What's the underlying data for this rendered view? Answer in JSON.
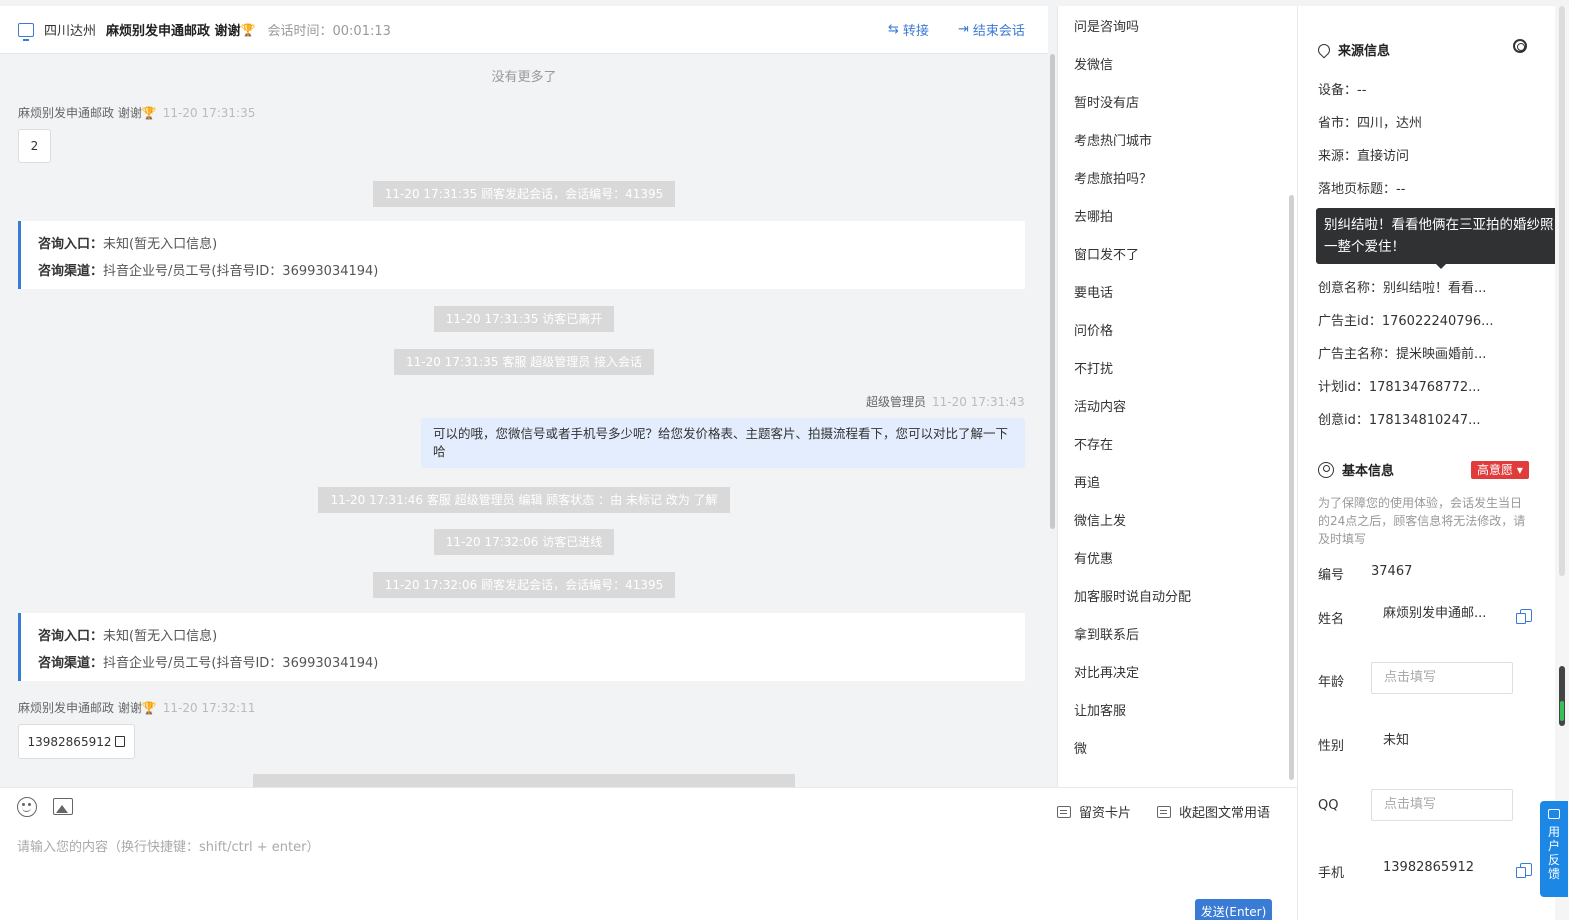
{
  "header": {
    "location": "四川达州",
    "visitor_name": "麻烦别发申通邮政 谢谢",
    "session_time": "会话时间：00:01:13",
    "transfer": "转接",
    "end_session": "结束会话"
  },
  "chat": {
    "no_more": "没有更多了",
    "visitor_label": "麻烦别发申通邮政 谢谢",
    "msg1_time": "11-20 17:31:35",
    "msg1_text": "2",
    "sys1": "11-20 17:31:35 顾客发起会话，会话编号：41395",
    "card1_entry_label": "咨询入口：",
    "card1_entry_val": "未知(暂无入口信息)",
    "card1_channel_label": "咨询渠道：",
    "card1_channel_val": "抖音企业号/员工号(抖音号ID：36993034194)",
    "sys2": "11-20 17:31:35 访客已离开",
    "sys3": "11-20 17:31:35 客服 超级管理员 接入会话",
    "agent_name": "超级管理员",
    "agent_time": "11-20 17:31:43",
    "agent_msg": "可以的哦，您微信号或者手机号多少呢？给您发价格表、主题客片、拍摄流程看下，您可以对比了解一下哈",
    "sys4": "11-20 17:31:46 客服 超级管理员 编辑 顾客状态 ：由 未标记 改为 了解",
    "sys5": "11-20 17:32:06 访客已进线",
    "sys6": "11-20 17:32:06 顾客发起会话，会话编号：41395",
    "card2_entry_label": "咨询入口：",
    "card2_entry_val": "未知(暂无入口信息)",
    "card2_channel_label": "咨询渠道：",
    "card2_channel_val": "抖音企业号/员工号(抖音号ID：36993034194)",
    "msg2_time": "11-20 17:32:11",
    "msg2_text": "13982865912"
  },
  "quick_replies": [
    "问是咨询吗",
    "发微信",
    "暂时没有店",
    "考虑热门城市",
    "考虑旅拍吗？",
    "去哪拍",
    "窗口发不了",
    "要电话",
    "问价格",
    "不打扰",
    "活动内容",
    "不存在",
    "再追",
    "微信上发",
    "有优惠",
    "加客服时说自动分配",
    "拿到联系后",
    "对比再决定",
    "让加客服",
    "微"
  ],
  "input": {
    "business_card": "留资卡片",
    "collapse_phrases": "收起图文常用语",
    "placeholder": "请输入您的内容（换行快捷键：shift/ctrl + enter）",
    "send": "发送(Enter)"
  },
  "source_info": {
    "title": "来源信息",
    "device": "设备：--",
    "province": "省市：四川，达州",
    "source": "来源：直接访问",
    "landing_title": "落地页标题：--",
    "tooltip": "别纠结啦！看看他俩在三亚拍的婚纱照 一整个爱住！",
    "creative_name": "创意名称：别纠结啦！看看...",
    "advertiser_id": "广告主id：176022240796...",
    "advertiser_name": "广告主名称：提米映画婚前...",
    "plan_id": "计划id：178134768772...",
    "creative_id": "创意id：178134810247..."
  },
  "basic_info": {
    "title": "基本信息",
    "intent_badge": "高意愿",
    "notice": "为了保障您的使用体验，会话发生当日的24点之后，顾客信息将无法修改，请及时填写",
    "id_label": "编号",
    "id_val": "37467",
    "name_label": "姓名",
    "name_val": "麻烦别发申通邮...",
    "age_label": "年龄",
    "age_placeholder": "点击填写",
    "gender_label": "性别",
    "gender_val": "未知",
    "qq_label": "QQ",
    "qq_placeholder": "点击填写",
    "phone_label": "手机",
    "phone_val": "13982865912"
  },
  "feedback": "用户反馈",
  "colors": {
    "accent": "#3a7bd5",
    "badge": "#e03c3c",
    "agent_bubble": "#e3edfd"
  }
}
